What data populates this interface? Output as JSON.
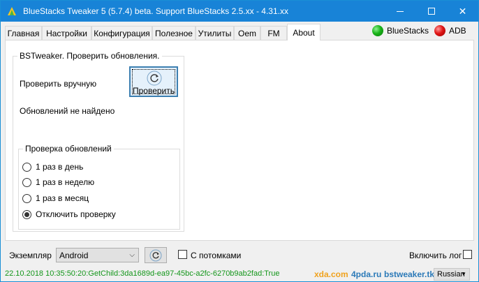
{
  "window": {
    "title": "BlueStacks Tweaker 5 (5.7.4) beta. Support BlueStacks 2.5.xx - 4.31.xx",
    "title_color": "#1883d7"
  },
  "tabs": [
    {
      "label": "Главная"
    },
    {
      "label": "Настройки"
    },
    {
      "label": "Конфигурация"
    },
    {
      "label": "Полезное"
    },
    {
      "label": "Утилиты"
    },
    {
      "label": "Oem"
    },
    {
      "label": "FM"
    },
    {
      "label": "About"
    }
  ],
  "status_indicators": {
    "bluestacks": {
      "label": "BlueStacks",
      "color": "#19b319"
    },
    "adb": {
      "label": "ADB",
      "color": "#e01515"
    }
  },
  "update_group": {
    "title": "BSTweaker. Проверить обновления.",
    "manual_label": "Проверить вручную",
    "check_button": "Проверить",
    "result_text": "Обновлений не найдено"
  },
  "schedule_group": {
    "title": "Проверка обновлений",
    "options": [
      {
        "label": "1 раз в день",
        "checked": false
      },
      {
        "label": "1 раз в неделю",
        "checked": false
      },
      {
        "label": "1 раз в месяц",
        "checked": false
      },
      {
        "label": "Отключить проверку",
        "checked": true
      }
    ]
  },
  "bottom": {
    "instance_label": "Экземпляр",
    "instance_value": "Android",
    "children_label": "С потомками",
    "log_label": "Включить лог"
  },
  "statusbar": {
    "text": "22.10.2018 10:35:50:20:GetChild:3da1689d-ea97-45bc-a2fc-6270b9ab2fad:True",
    "text_color": "#13961a",
    "links": [
      {
        "label": "xda.com",
        "color": "#f0a21e"
      },
      {
        "label": "4pda.ru",
        "color": "#2c7ab8"
      },
      {
        "label": "bstweaker.tk",
        "color": "#2c7ab8"
      }
    ],
    "language": "Russian"
  }
}
